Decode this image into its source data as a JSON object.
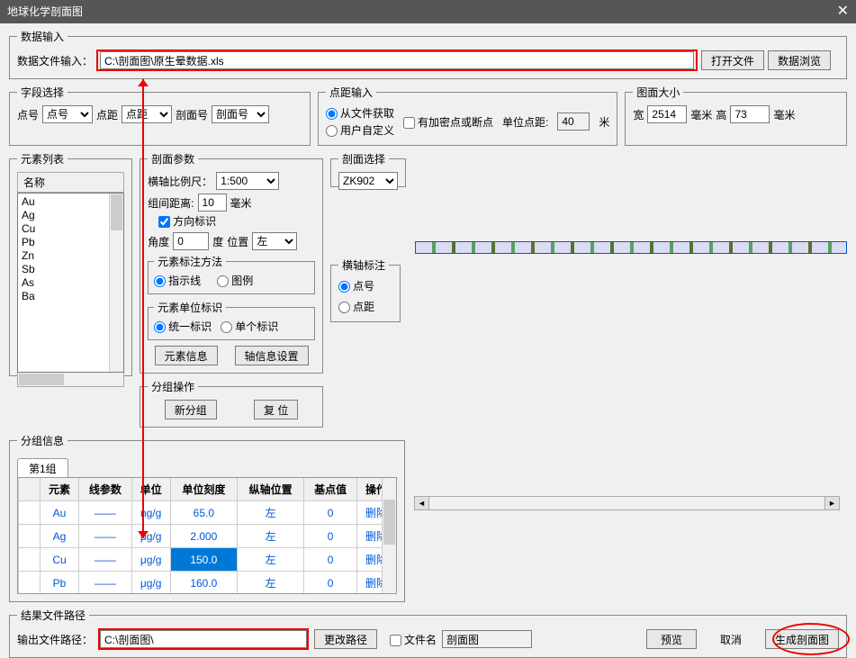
{
  "window": {
    "title": "地球化学剖面图"
  },
  "data_input": {
    "legend": "数据输入",
    "label": "数据文件输入：",
    "path": "C:\\剖面图\\原生晕数据.xls",
    "open_btn": "打开文件",
    "browse_btn": "数据浏览"
  },
  "field_select": {
    "legend": "字段选择",
    "pointno_label": "点号",
    "pointno_val": "点号",
    "dist_label": "点距",
    "dist_val": "点距",
    "section_label": "剖面号",
    "section_val": "剖面号"
  },
  "dist_input": {
    "legend": "点距输入",
    "from_file": "从文件获取",
    "user_def": "用户自定义",
    "dense_chk": "有加密点或断点",
    "unit_dist_label": "单位点距:",
    "unit_dist_val": "40",
    "unit": "米"
  },
  "pic_size": {
    "legend": "图面大小",
    "w_label": "宽",
    "w_val": "2514",
    "w_unit": "毫米",
    "h_label": "高",
    "h_val": "73",
    "h_unit": "毫米"
  },
  "elem_list": {
    "legend": "元素列表",
    "header": "名称",
    "items": [
      "Au",
      "Ag",
      "Cu",
      "Pb",
      "Zn",
      "Sb",
      "As",
      "Ba"
    ]
  },
  "section_params": {
    "legend": "剖面参数",
    "hscale_label": "横轴比例尺：",
    "hscale_val": "1:500",
    "grp_dist_label": "组间距离:",
    "grp_dist_val": "10",
    "grp_dist_unit": "毫米",
    "dir_mark": "方向标识",
    "angle_label": "角度",
    "angle_val": "0",
    "angle_unit": "度",
    "pos_label": "位置",
    "pos_val": "左",
    "mark_method_legend": "元素标注方法",
    "mark_line": "指示线",
    "mark_legend": "图例",
    "unit_mark_legend": "元素单位标识",
    "unit_unified": "统一标识",
    "unit_single": "单个标识",
    "elem_info_btn": "元素信息",
    "axis_info_btn": "轴信息设置"
  },
  "section_select": {
    "legend": "剖面选择",
    "val": "ZK902"
  },
  "haxis_mark": {
    "legend": "横轴标注",
    "pointno": "点号",
    "dist": "点距"
  },
  "group_ops": {
    "legend": "分组操作",
    "new_btn": "新分组",
    "reset_btn": "复 位"
  },
  "group_info": {
    "legend": "分组信息",
    "tab1": "第1组",
    "cols": [
      "元素",
      "线参数",
      "单位",
      "单位刻度",
      "纵轴位置",
      "基点值",
      "操作"
    ],
    "rows": [
      {
        "elem": "Au",
        "line": "——",
        "unit": "ng/g",
        "scale": "65.0",
        "ypos": "左",
        "base": "0",
        "op": "删除"
      },
      {
        "elem": "Ag",
        "line": "——",
        "unit": "μg/g",
        "scale": "2.000",
        "ypos": "左",
        "base": "0",
        "op": "删除"
      },
      {
        "elem": "Cu",
        "line": "——",
        "unit": "μg/g",
        "scale": "150.0",
        "ypos": "左",
        "base": "0",
        "op": "删除",
        "selected": true
      },
      {
        "elem": "Pb",
        "line": "——",
        "unit": "μg/g",
        "scale": "160.0",
        "ypos": "左",
        "base": "0",
        "op": "删除"
      }
    ]
  },
  "result_path": {
    "legend": "结果文件路径",
    "label": "输出文件路径：",
    "path": "C:\\剖面图\\",
    "change_btn": "更改路径",
    "fname_chk": "文件名",
    "fname_val": "剖面图"
  },
  "buttons": {
    "preview": "预览",
    "cancel": "取消",
    "generate": "生成剖面图"
  }
}
